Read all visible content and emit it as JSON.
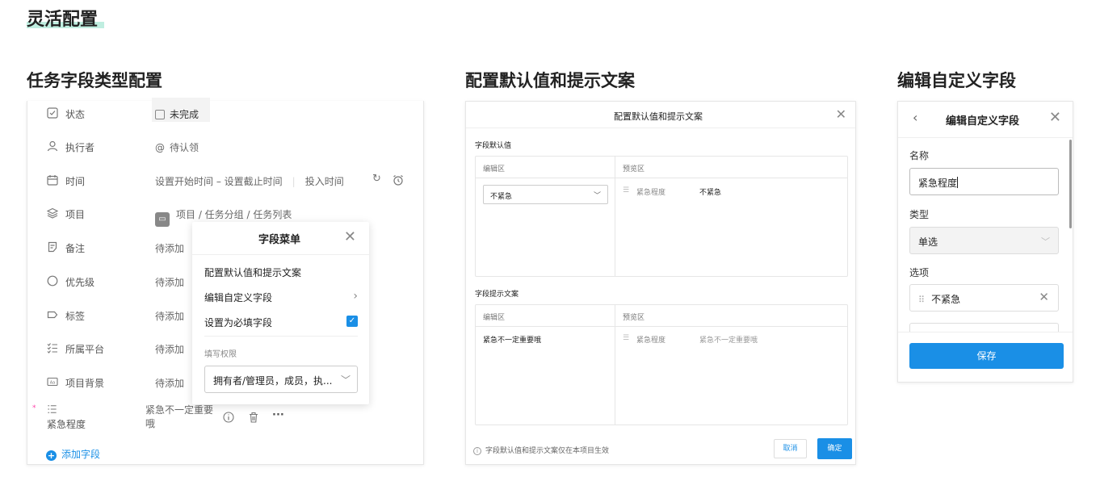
{
  "page_title": "灵活配置",
  "sections": {
    "task_fields": "任务字段类型配置",
    "default_values": "配置默认值和提示文案",
    "edit_custom": "编辑自定义字段"
  },
  "task_panel": {
    "rows": [
      {
        "label": "状态",
        "value": "未完成"
      },
      {
        "label": "执行者",
        "value": "待认领"
      },
      {
        "label": "时间",
        "value": "设置开始时间 – 设置截止时间",
        "extra": "投入时间"
      },
      {
        "label": "项目",
        "value": "项目 / 任务分组 / 任务列表"
      },
      {
        "label": "备注",
        "value": "待添加"
      },
      {
        "label": "优先级",
        "value": "待添加"
      },
      {
        "label": "标签",
        "value": "待添加"
      },
      {
        "label": "所属平台",
        "value": "待添加"
      },
      {
        "label": "项目背景",
        "value": "待添加"
      }
    ],
    "custom_field": {
      "label": "紧急程度",
      "value_line1": "紧急不一定重要",
      "value_line2": "哦",
      "required_mark": "*"
    },
    "add_field": "添加字段"
  },
  "field_menu": {
    "title": "字段菜单",
    "items": [
      "配置默认值和提示文案",
      "编辑自定义字段",
      "设置为必填字段"
    ],
    "required_checked": true,
    "permission_label": "填写权限",
    "permission_value": "拥有者/管理员，成员，执..."
  },
  "default_dialog": {
    "title": "配置默认值和提示文案",
    "default_section": "字段默认值",
    "hint_section": "字段提示文案",
    "edit_col": "编辑区",
    "preview_col": "预览区",
    "default_select": "不紧急",
    "preview_field_name": "紧急程度",
    "preview_default": "不紧急",
    "hint_text": "紧急不一定重要哦",
    "footnote": "字段默认值和提示文案仅在本项目生效",
    "cancel": "取消",
    "confirm": "确定"
  },
  "edit_panel": {
    "title": "编辑自定义字段",
    "name_label": "名称",
    "name_value": "紧急程度",
    "type_label": "类型",
    "type_value": "单选",
    "options_label": "选项",
    "option_1": "不紧急",
    "save": "保存"
  },
  "colors": {
    "accent": "#1a8fe6",
    "title_underline": "#bfeee0"
  }
}
